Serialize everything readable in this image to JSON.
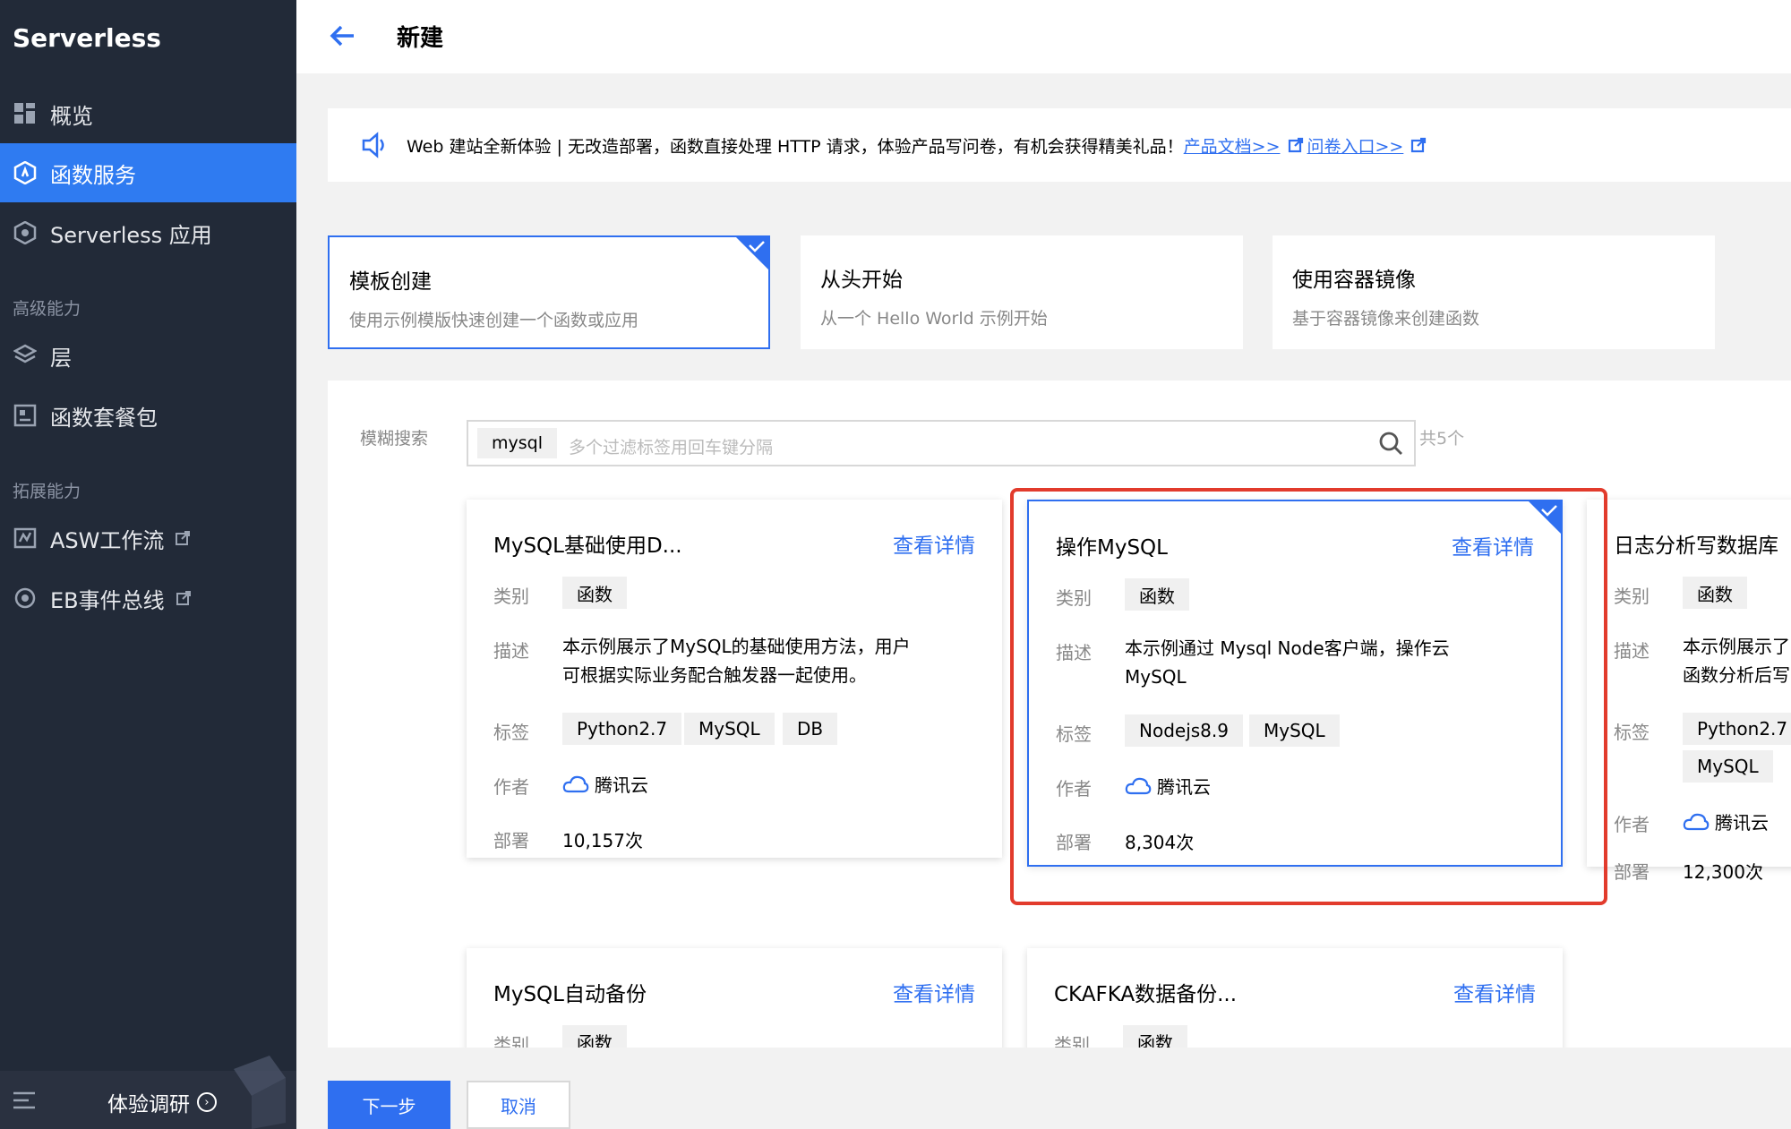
{
  "sidebar": {
    "brand": "Serverless",
    "items": [
      {
        "label": "概览",
        "icon": "grid-icon"
      },
      {
        "label": "函数服务",
        "icon": "function-icon",
        "active": true
      },
      {
        "label": "Serverless 应用",
        "icon": "app-icon"
      }
    ],
    "section_advanced": "高级能力",
    "advanced_items": [
      {
        "label": "层",
        "icon": "layers-icon"
      },
      {
        "label": "函数套餐包",
        "icon": "package-icon"
      }
    ],
    "section_extend": "拓展能力",
    "extend_items": [
      {
        "label": "ASW工作流",
        "icon": "workflow-icon"
      },
      {
        "label": "EB事件总线",
        "icon": "eventbus-icon"
      }
    ],
    "footer_label": "体验调研"
  },
  "header": {
    "title": "新建"
  },
  "notice": {
    "text": "Web 建站全新体验 | 无改造部署，函数直接处理 HTTP 请求，体验产品写问卷，有机会获得精美礼品！",
    "link1": "产品文档>>",
    "link2": "问卷入口>>"
  },
  "modes": [
    {
      "title": "模板创建",
      "desc": "使用示例模版快速创建一个函数或应用",
      "selected": true
    },
    {
      "title": "从头开始",
      "desc": "从一个 Hello World 示例开始"
    },
    {
      "title": "使用容器镜像",
      "desc": "基于容器镜像来创建函数"
    }
  ],
  "search": {
    "label": "模糊搜索",
    "tag": "mysql",
    "placeholder": "多个过滤标签用回车键分隔",
    "count": "共5个"
  },
  "labels": {
    "category": "类别",
    "description": "描述",
    "tags": "标签",
    "author": "作者",
    "deploy": "部署",
    "detail": "查看详情"
  },
  "templates": [
    {
      "name": "MySQL基础使用D...",
      "category": "函数",
      "desc_line1": "本示例展示了MySQL的基础使用方法，用户",
      "desc_line2": "可根据实际业务配合触发器一起使用。",
      "tags": [
        "Python2.7",
        "MySQL",
        "DB"
      ],
      "author": "腾讯云",
      "deploys": "10,157次"
    },
    {
      "name": "操作MySQL",
      "category": "函数",
      "desc_line1": "本示例通过 Mysql Node客户端，操作云",
      "desc_line2": "MySQL",
      "tags": [
        "Nodejs8.9",
        "MySQL"
      ],
      "author": "腾讯云",
      "deploys": "8,304次",
      "selected": true
    },
    {
      "name": "日志分析写数据库",
      "category": "函数",
      "desc_line1": "本示例展示了",
      "desc_line2": "函数分析后写",
      "tags": [
        "Python2.7",
        "MySQL"
      ],
      "author": "腾讯云",
      "deploys": "12,300次"
    },
    {
      "name": "MySQL自动备份",
      "category": "函数"
    },
    {
      "name": "CKAFKA数据备份...",
      "category": "函数"
    }
  ],
  "buttons": {
    "next": "下一步",
    "cancel": "取消"
  },
  "colors": {
    "sidebar_bg": "#222a38",
    "accent": "#2f6ff0",
    "highlight": "#e23b2c"
  }
}
